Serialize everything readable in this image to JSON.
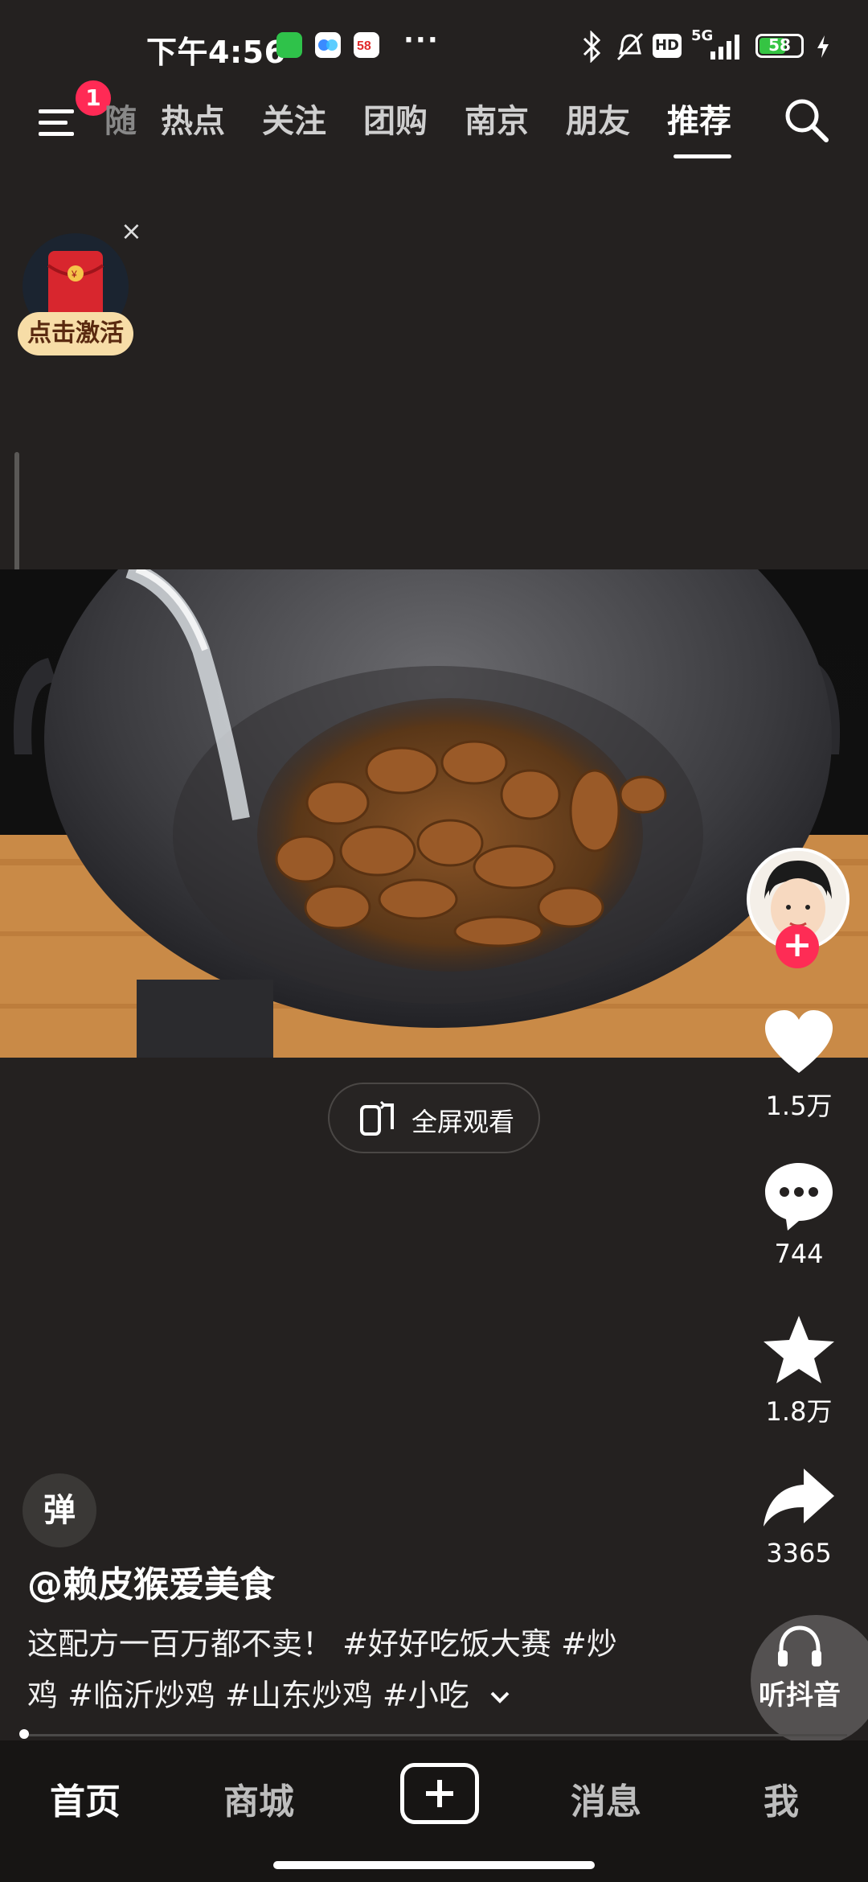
{
  "status_bar": {
    "time": "下午4:56",
    "dots": "···",
    "network": "5G",
    "hd": "HD",
    "battery": "58"
  },
  "top_tabs": {
    "menu_badge": "1",
    "cut_tab": "随",
    "tabs": [
      "热点",
      "关注",
      "团购",
      "南京",
      "朋友",
      "推荐"
    ],
    "active": "推荐"
  },
  "red_envelope": {
    "label": "点击激活",
    "close": "×"
  },
  "video": {
    "fullscreen_label": "全屏观看"
  },
  "actions": {
    "likes": "1.5万",
    "comments": "744",
    "favorites": "1.8万",
    "shares": "3365"
  },
  "info": {
    "danmaku_btn": "弹",
    "author": "@赖皮猴爱美食",
    "description_line1": "这配方一百万都不卖！ #好好吃饭大赛 #炒",
    "description_line2": "鸡 #临沂炒鸡 #山东炒鸡 #小吃",
    "listen_label": "听抖音"
  },
  "bottom_nav": {
    "home": "首页",
    "mall": "商城",
    "messages": "消息",
    "me": "我"
  },
  "colors": {
    "background": "#242120",
    "accent_red": "#fe2c55",
    "pill": "#f7dda7"
  }
}
